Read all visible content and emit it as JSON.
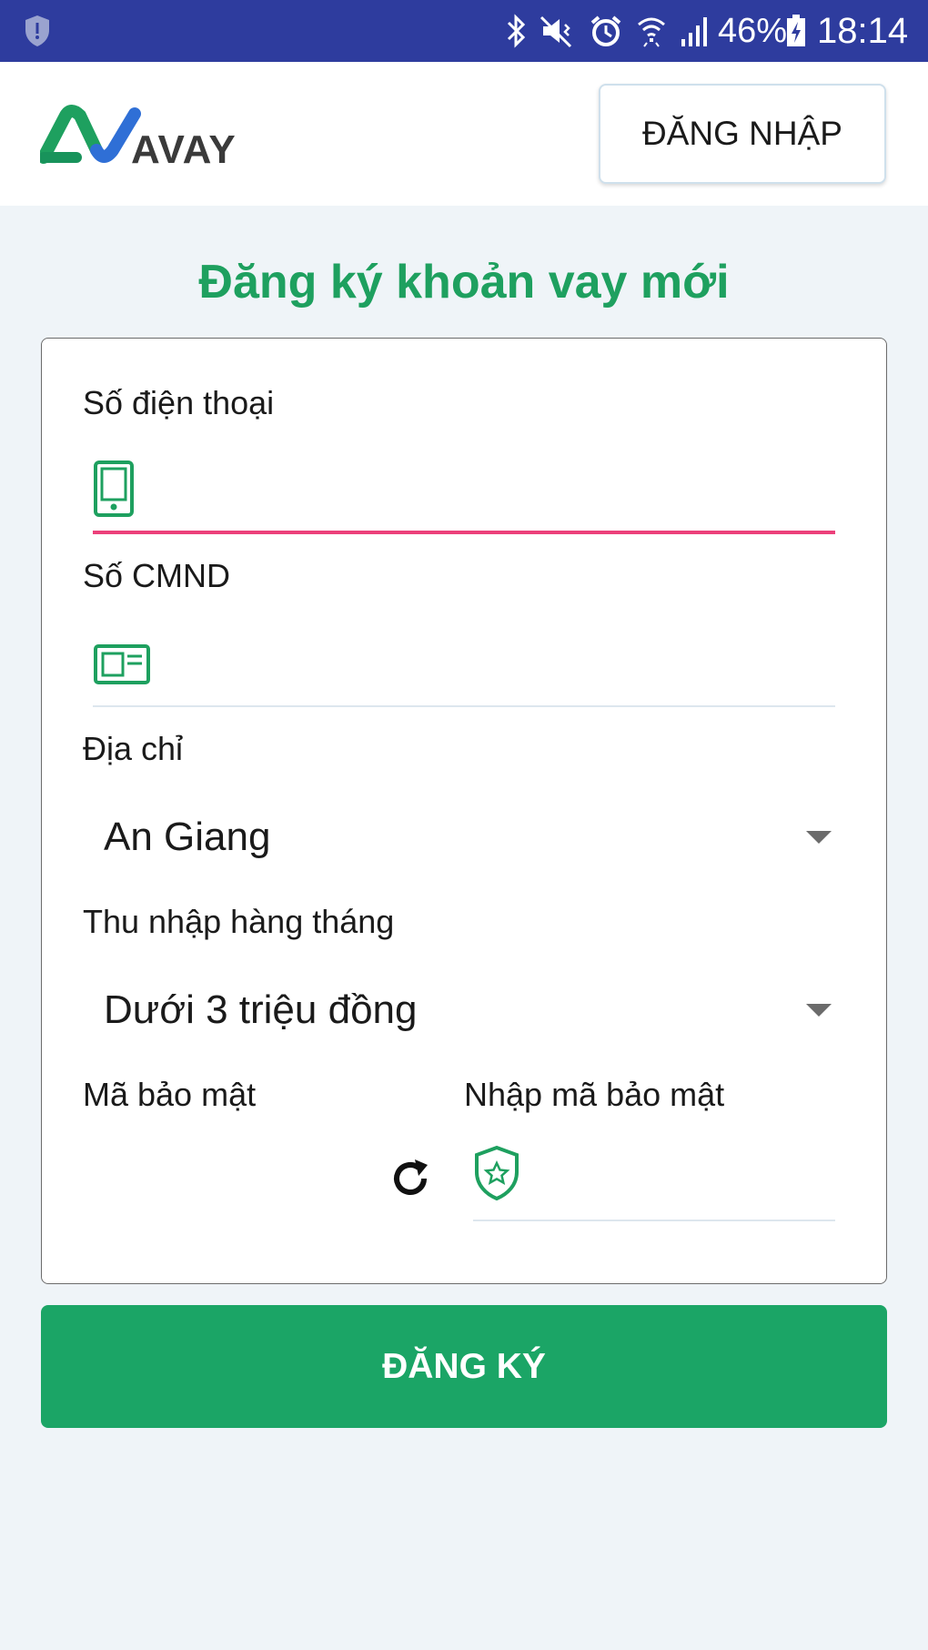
{
  "status_bar": {
    "battery_percent": "46%",
    "time": "18:14",
    "icons": [
      "security-shield-icon",
      "bluetooth-icon",
      "mute-vibrate-icon",
      "alarm-icon",
      "wifi-icon",
      "signal-icon",
      "battery-charging-icon"
    ]
  },
  "header": {
    "logo_text": "AVAY",
    "login_label": "ĐĂNG NHẬP"
  },
  "title": "Đăng ký khoản vay mới",
  "form": {
    "phone": {
      "label": "Số điện thoại",
      "value": ""
    },
    "id_card": {
      "label": "Số CMND",
      "value": ""
    },
    "address": {
      "label": "Địa chỉ",
      "selected": "An Giang"
    },
    "income": {
      "label": "Thu nhập hàng tháng",
      "selected": "Dưới 3 triệu đồng"
    },
    "captcha": {
      "label": "Mã bảo mật",
      "input_label": "Nhập mã bảo mật",
      "value": ""
    }
  },
  "register_label": "ĐĂNG KÝ",
  "colors": {
    "status_bar": "#2e3c9e",
    "brand_green": "#1ba566",
    "active_underline": "#ec407a",
    "background": "#eff4f8"
  }
}
